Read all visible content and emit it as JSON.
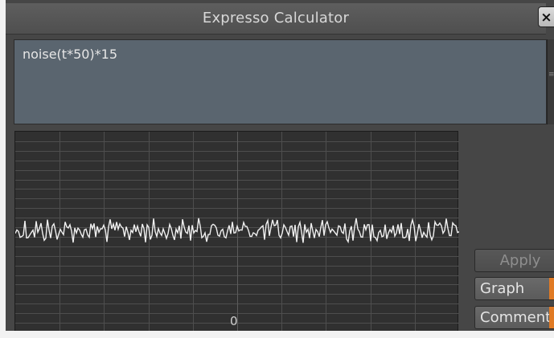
{
  "window": {
    "title": "Expresso Calculator",
    "close_glyph": "×"
  },
  "editor": {
    "expression": "noise(t*50)*15"
  },
  "graph": {
    "axis_label": "0",
    "line_color": "#f0f0f0",
    "grid_color": "#4e4e4e"
  },
  "buttons": {
    "apply_label": "Apply",
    "graph_label": "Graph",
    "comment_label": "Comment"
  },
  "accent_color": "#e07a24"
}
